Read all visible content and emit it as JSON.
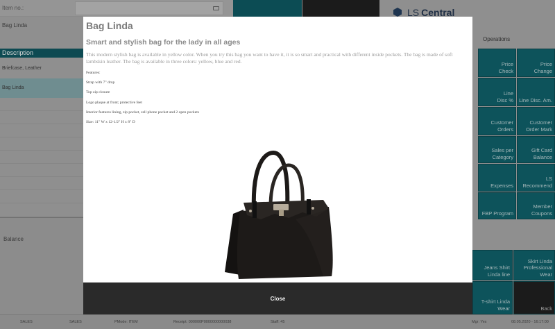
{
  "header": {
    "item_no_label": "Item no.:",
    "item_name": "Bag Linda",
    "logo_prefix": "LS",
    "logo_name": "Central"
  },
  "lines": {
    "description_header": "Description",
    "items": [
      "Briefcase, Leather",
      "Bag Linda"
    ],
    "balance_label": "Balance"
  },
  "operations": {
    "title": "Operations",
    "buttons": [
      {
        "line1": "Price",
        "line2": "Check"
      },
      {
        "line1": "Price",
        "line2": "Change"
      },
      {
        "line1": "Line",
        "line2": "Disc %"
      },
      {
        "line1": "",
        "line2": "Line Disc. Am."
      },
      {
        "line1": "Customer",
        "line2": "Orders"
      },
      {
        "line1": "Customer",
        "line2": "Order Mark"
      },
      {
        "line1": "Sales per",
        "line2": "Category"
      },
      {
        "line1": "Gift Card",
        "line2": "Balance"
      },
      {
        "line1": "",
        "line2": "Expenses"
      },
      {
        "line1": "LS",
        "line2": "Recommend"
      },
      {
        "line1": "",
        "line2": "FBP Program"
      },
      {
        "line1": "Member",
        "line2": "Coupons"
      }
    ]
  },
  "product_buttons": {
    "jeans": {
      "line1": "Jeans Shirt",
      "line2": "Linda line"
    },
    "skirt": {
      "line1": "Skirt Linda",
      "line2": "Professional",
      "line3": "Wear"
    },
    "tshirt": {
      "line1": "T-shirt Linda",
      "line2": "Wear"
    },
    "back": "Back"
  },
  "status": {
    "left1": "SALES",
    "left2": "SALES",
    "pmode": "PMode: ITEM",
    "receipt": "Receipt: 000000P0000000000038",
    "staff": "Staff: 45",
    "mgr": "Mgr: Yes",
    "datetime": "08.05.2020 - 16:17:00"
  },
  "modal": {
    "title": "Bag Linda",
    "subtitle": "Smart and stylish bag for the lady in all ages",
    "intro": "This modern stylish bag is available in yellow color. When you try this bag you want to have it, it is so smart and practical with different inside pockets. The bag is made of soft lambskin leather. The bag is available in three colors: yellow, blue and red.",
    "features": [
      "Features:",
      "Strap with 7\" drop",
      "Top zip closure",
      "Logo plaque at front; protective feet",
      "Interior features lining, zip pocket, cell phone pocket and 2 open pockets",
      "Size: 11\" W x 12-1/2\" H x 8\" D"
    ],
    "close_label": "Close"
  },
  "colors": {
    "teal": "#0d535b",
    "modal_bg": "#ffffff",
    "close_bar": "#2a2a2a",
    "bag": "#1d1a18"
  }
}
